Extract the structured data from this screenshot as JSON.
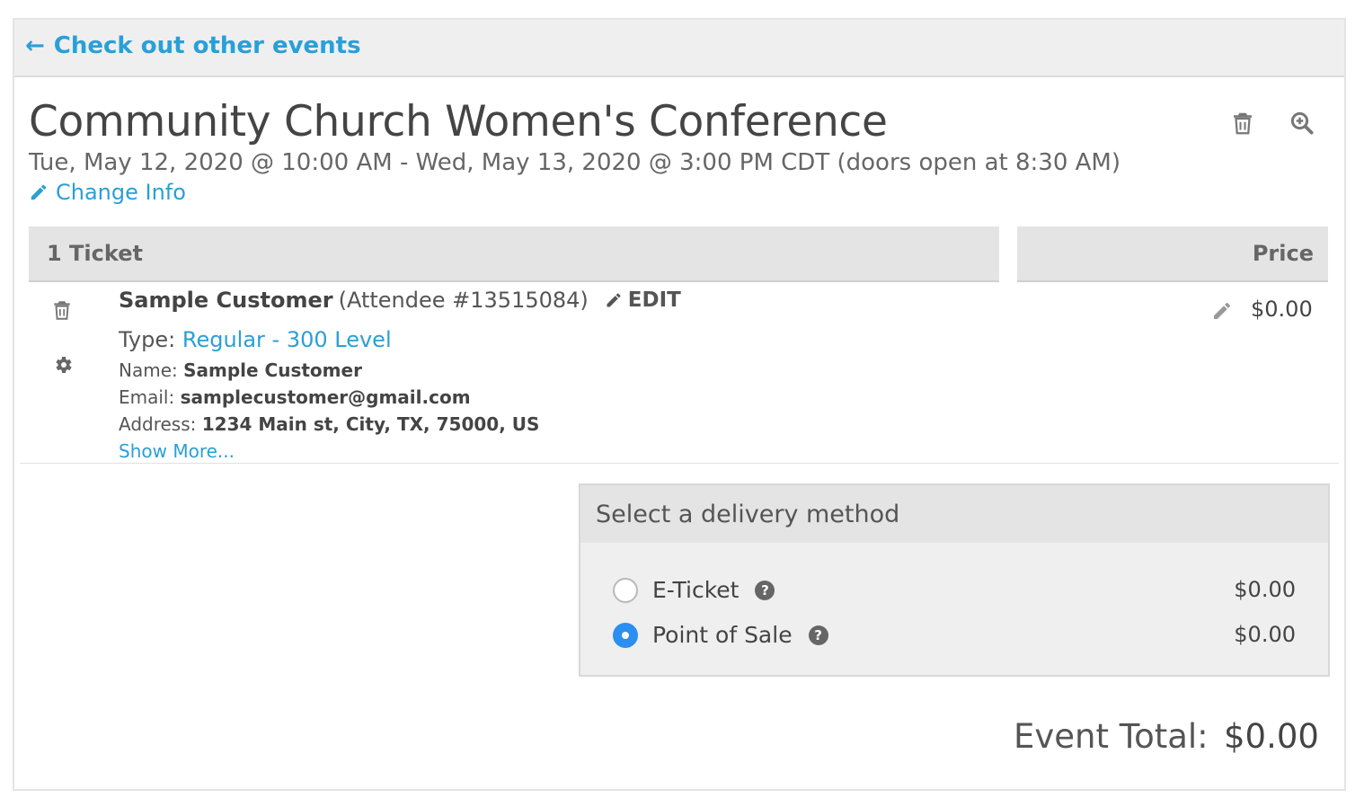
{
  "header": {
    "back_arrow": "←",
    "back_label": "Check out other events"
  },
  "event": {
    "title": "Community Church Women's Conference",
    "dates": "Tue, May 12, 2020 @ 10:00 AM - Wed, May 13, 2020 @ 3:00 PM CDT (doors open at 8:30 AM)",
    "change_info_label": "Change Info"
  },
  "table": {
    "ticket_header": "1 Ticket",
    "price_header": "Price"
  },
  "ticket": {
    "customer_name": "Sample Customer",
    "attendee_number": "(Attendee #13515084)",
    "edit_label": "EDIT",
    "type_label": "Type:",
    "type_value": "Regular - 300 Level",
    "name_label": "Name:",
    "name_value": "Sample Customer",
    "email_label": "Email:",
    "email_value": "samplecustomer@gmail.com",
    "address_label": "Address:",
    "address_value": "1234 Main st, City, TX, 75000, US",
    "show_more": "Show More...",
    "price": "$0.00"
  },
  "delivery": {
    "heading": "Select a delivery method",
    "options": [
      {
        "label": "E-Ticket",
        "price": "$0.00",
        "selected": false
      },
      {
        "label": "Point of Sale",
        "price": "$0.00",
        "selected": true
      }
    ],
    "help_glyph": "?"
  },
  "totals": {
    "label": "Event Total:",
    "value": "$0.00"
  },
  "colors": {
    "link": "#2a9fd8",
    "radio_selected": "#2a8ff0",
    "header_bg": "#e4e4e4"
  }
}
